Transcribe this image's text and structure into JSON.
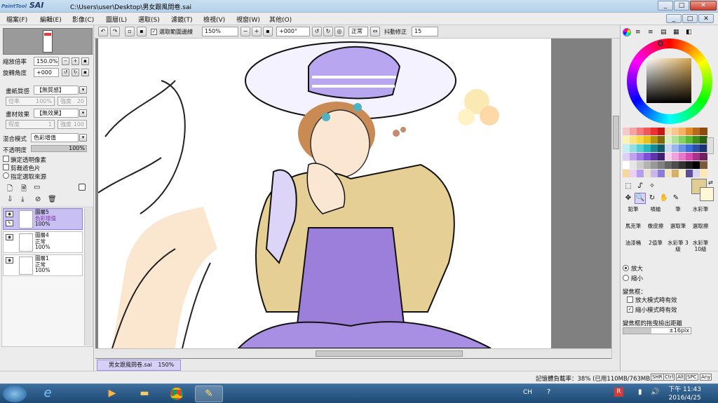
{
  "window": {
    "logo_small": "PaintTool",
    "logo_big": "SAI",
    "title": "C:\\Users\\user\\Desktop\\男女跟風問卷.sai",
    "min_label": "_",
    "max_label": "□",
    "close_label": "✕",
    "restore_label": "□"
  },
  "menu": [
    "檔案(F)",
    "編輯(E)",
    "影像(C)",
    "圖層(L)",
    "選取(S)",
    "濾鏡(T)",
    "檢視(V)",
    "視窗(W)",
    "其他(O)"
  ],
  "toolbar": {
    "select_checkbox_label": "選取範圍邊線",
    "zoom": "150%",
    "rotation": "+000°",
    "blend_mode": "正常",
    "stabilizer_label": "抖動修正",
    "stabilizer": "15"
  },
  "navigator": {
    "zoom_label": "縮放倍率",
    "zoom_value": "150.0%",
    "rotate_label": "旋轉角度",
    "rotate_value": "+000"
  },
  "texture": {
    "paper_label": "畫紙質感",
    "paper_value": "【無質感】",
    "paper_scale_label": "倍率",
    "paper_scale_value": "100%",
    "paper_strength_label": "強度",
    "paper_strength_value": "20",
    "effect_label": "畫材效果",
    "effect_value": "【無效果】",
    "effect_level_label": "程度",
    "effect_level_value": "1",
    "effect_strength_label": "強度",
    "effect_strength_value": "100"
  },
  "layer_props": {
    "blend_label": "混合模式",
    "blend_value": "色彩增值",
    "opacity_label": "不透明度",
    "opacity_value": "100%",
    "opacity_fraction": 1.0,
    "lock_alpha": "鎖定透明像素",
    "clip": "剪裁遮色片",
    "select_source": "指定選取來源"
  },
  "layers": [
    {
      "name": "圖層5",
      "mode": "色彩增值",
      "opacity": "100%",
      "selected": true
    },
    {
      "name": "圖層4",
      "mode": "正常",
      "opacity": "100%",
      "selected": false
    },
    {
      "name": "圖層1",
      "mode": "正常",
      "opacity": "100%",
      "selected": false
    }
  ],
  "document_tab": {
    "name": "男女跟風問卷.sai",
    "zoom": "150%"
  },
  "palette_colors": [
    "#f3c9c9",
    "#f6a3a3",
    "#f47c7c",
    "#f15757",
    "#ee3030",
    "#c41919",
    "#f7dcb5",
    "#f8c78c",
    "#f8b164",
    "#e08b2c",
    "#b8691b",
    "#8a4c10",
    "#fbf2b8",
    "#f9e681",
    "#f7d847",
    "#e6c21a",
    "#b49614",
    "#7c6810",
    "#d7f0c4",
    "#b0e196",
    "#85cf63",
    "#5ab834",
    "#3e8c1f",
    "#2a5e14",
    "#c4eff0",
    "#8fdfe3",
    "#55cfd6",
    "#27b7c2",
    "#1b8893",
    "#135a63",
    "#c9d8f5",
    "#9bb6ee",
    "#6b91e5",
    "#3d6bd9",
    "#2c4ea6",
    "#1c3270",
    "#ddd0f5",
    "#c0a5ee",
    "#a07ae5",
    "#7f4fd9",
    "#5f35a8",
    "#3e2170",
    "#f5d0ec",
    "#eea4db",
    "#e777c9",
    "#d84bb1",
    "#a6328a",
    "#70205d",
    "#ffffff",
    "#e6e6e6",
    "#cccccc",
    "#b3b3b3",
    "#999999",
    "#808080",
    "#666666",
    "#4d4d4d",
    "#333333",
    "#1a1a1a",
    "#000000",
    "#7a5a3a",
    "#f6d7a0",
    "#ead0f4",
    "#b59ef0",
    "#e9e4d0",
    "#c7b8e9",
    "#8c7dd6",
    "#f2e6c2",
    "#d3b06b",
    "#f7f0d2",
    "#5f4e9c",
    "#d9d5f0",
    "#ffe9b3"
  ],
  "current_color": "#e1cc94",
  "secondary_color": "#fff8d6",
  "tools": {
    "row1": [
      "marquee-icon",
      "lasso-icon",
      "magic-wand-icon"
    ],
    "row2": [
      "move-icon",
      "zoom-icon",
      "rotate-icon",
      "hand-icon",
      "eyedropper-icon"
    ]
  },
  "brushes": [
    "鉛筆",
    "噴槍",
    "筆",
    "水彩筆",
    "馬克筆",
    "橡皮擦",
    "選取筆",
    "選取擦",
    "油漆桶",
    "2值筆",
    "水彩筆 3級",
    "水彩筆 10級"
  ],
  "zoom_options": {
    "zoom_in": "放大",
    "zoom_out": "縮小",
    "frame_label": "變焦框：",
    "opt_in_mode": "放大模式時有效",
    "opt_out_mode": "縮小模式時有效",
    "drag_label": "變焦框的拖曳檢出距離",
    "drag_value": "±16pix"
  },
  "status": {
    "memory": "記憶體負載率：38% (已用110MB/763MB)",
    "keys": [
      "SHR",
      "Ctrl",
      "Alt",
      "SPC",
      "Any"
    ]
  },
  "taskbar": {
    "lang": "CH",
    "time": "下午 11:43",
    "date": "2016/4/25",
    "apps": [
      "start-icon",
      "ie-icon",
      "media-player-icon",
      "explorer-icon",
      "chrome-icon",
      "paint-tool-sai-icon"
    ]
  }
}
